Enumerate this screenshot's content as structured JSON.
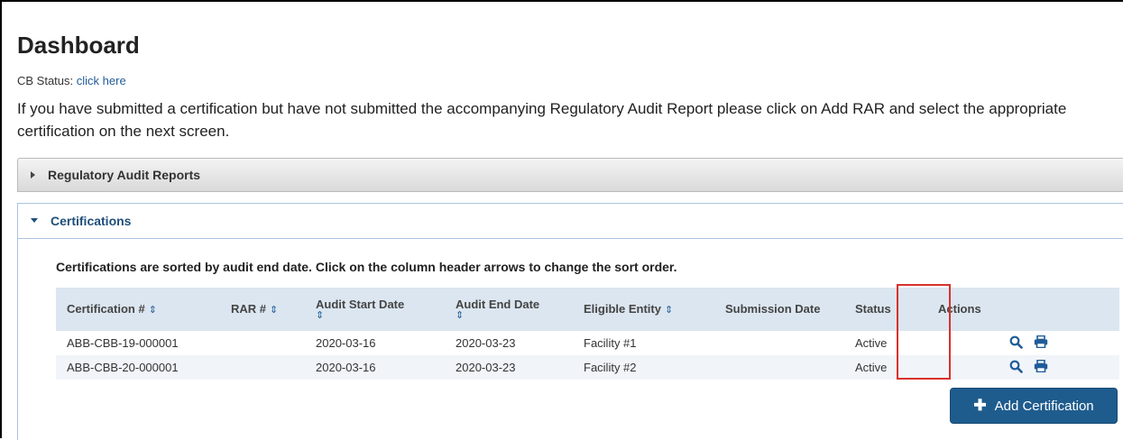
{
  "page": {
    "title": "Dashboard",
    "cb_status_label": "CB Status:",
    "cb_status_link": "click here",
    "intro_text": "If you have submitted a certification but have not submitted the accompanying Regulatory Audit Report please click on Add RAR and select the appropriate certification on the next screen."
  },
  "panels": {
    "rar": {
      "label": "Regulatory Audit Reports",
      "expanded": false
    },
    "certifications": {
      "label": "Certifications",
      "expanded": true
    }
  },
  "certifications": {
    "sort_note": "Certifications are sorted by audit end date. Click on the column header arrows to change the sort order.",
    "columns": [
      {
        "label": "Certification #",
        "sortable": true
      },
      {
        "label": "RAR #",
        "sortable": true
      },
      {
        "label": "Audit Start Date",
        "sortable": true
      },
      {
        "label": "Audit End Date",
        "sortable": true
      },
      {
        "label": "Eligible Entity",
        "sortable": true
      },
      {
        "label": "Submission Date",
        "sortable": false
      },
      {
        "label": "Status",
        "sortable": false
      },
      {
        "label": "Actions",
        "sortable": false
      }
    ],
    "sort_icon": "⇕",
    "rows": [
      {
        "cert": "ABB-CBB-19-000001",
        "rar": "",
        "start": "2020-03-16",
        "end": "2020-03-23",
        "entity": "Facility #1",
        "submission": "",
        "status": "Active"
      },
      {
        "cert": "ABB-CBB-20-000001",
        "rar": "",
        "start": "2020-03-16",
        "end": "2020-03-23",
        "entity": "Facility #2",
        "submission": "",
        "status": "Active"
      }
    ],
    "action_icons": [
      "search-icon",
      "print-icon"
    ],
    "add_button_label": "Add Certification"
  },
  "colors": {
    "link": "#1f5c99",
    "header_bg": "#dce6f0",
    "button_bg": "#1f5c8e",
    "highlight": "#d9302c"
  }
}
